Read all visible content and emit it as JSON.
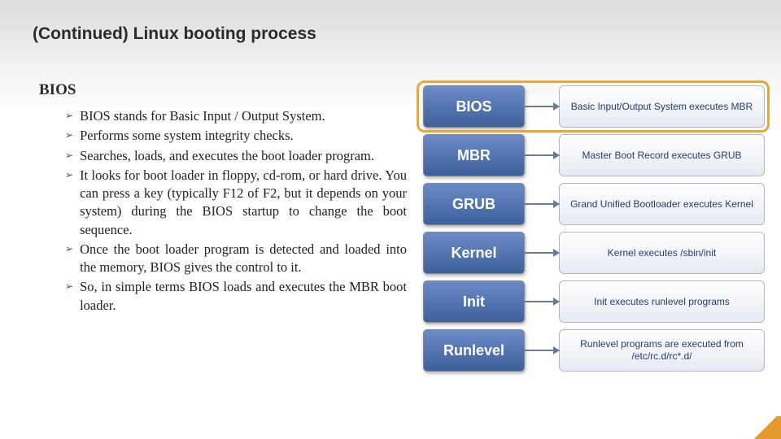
{
  "title": "(Continued) Linux booting process",
  "section": "BIOS",
  "bullets": [
    "BIOS stands for Basic Input / Output System.",
    "Performs some system integrity checks.",
    "Searches, loads, and executes the boot loader program.",
    "It looks for boot loader in floppy, cd-rom, or hard drive. You can press a key (typically F12 of F2, but it depends on your system) during the BIOS startup to change the boot sequence.",
    "Once the boot loader program is detected and loaded into the memory, BIOS gives the control to it.",
    "So, in simple terms BIOS loads and executes the MBR boot loader."
  ],
  "diagram": [
    {
      "stage": "BIOS",
      "desc": "Basic Input/Output System executes MBR"
    },
    {
      "stage": "MBR",
      "desc": "Master Boot Record executes GRUB"
    },
    {
      "stage": "GRUB",
      "desc": "Grand Unified Bootloader executes Kernel"
    },
    {
      "stage": "Kernel",
      "desc": "Kernel executes /sbin/init"
    },
    {
      "stage": "Init",
      "desc": "Init executes runlevel programs"
    },
    {
      "stage": "Runlevel",
      "desc": "Runlevel programs are executed from /etc/rc.d/rc*.d/"
    }
  ],
  "highlight_index": 0
}
